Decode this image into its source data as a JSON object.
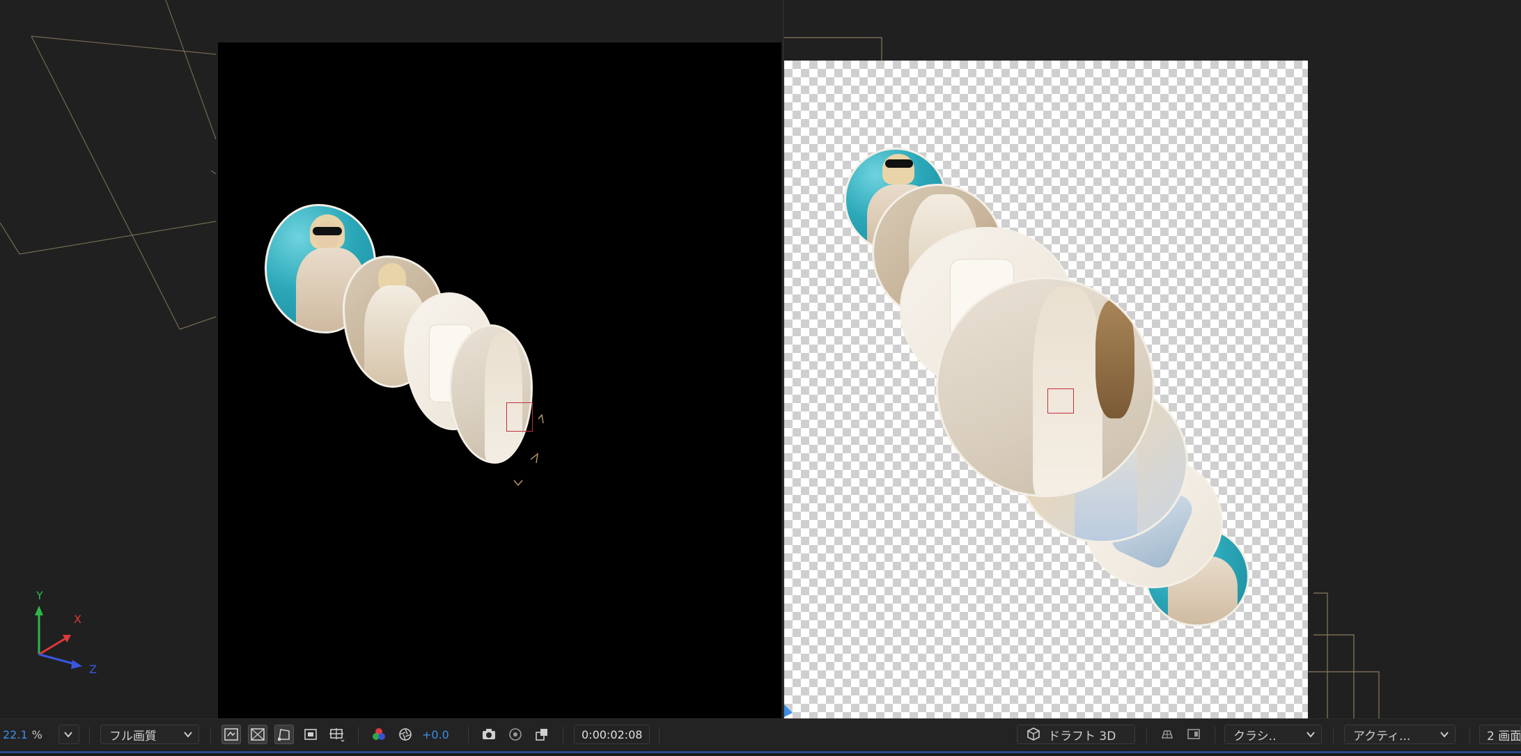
{
  "toolbar": {
    "zoom_value": "22.1",
    "zoom_unit": "%",
    "resolution": "フル画質",
    "exposure": "+0.0",
    "timecode": "0:00:02:08",
    "renderer": "ドラフト 3D",
    "view_layout_menu": "クラシ..",
    "active_camera": "アクティ...",
    "view_count": "2 画面"
  },
  "axis_gizmo": {
    "y_label": "Y",
    "x_label": "X",
    "z_label": "Z",
    "colors": {
      "x": "#e0393b",
      "y": "#2fb84a",
      "z": "#3a56e0"
    }
  },
  "colors": {
    "accent": "#3a8ee6",
    "panel_bg": "#202020",
    "selection": "#c0303a",
    "guide": "#8a7a5e"
  }
}
